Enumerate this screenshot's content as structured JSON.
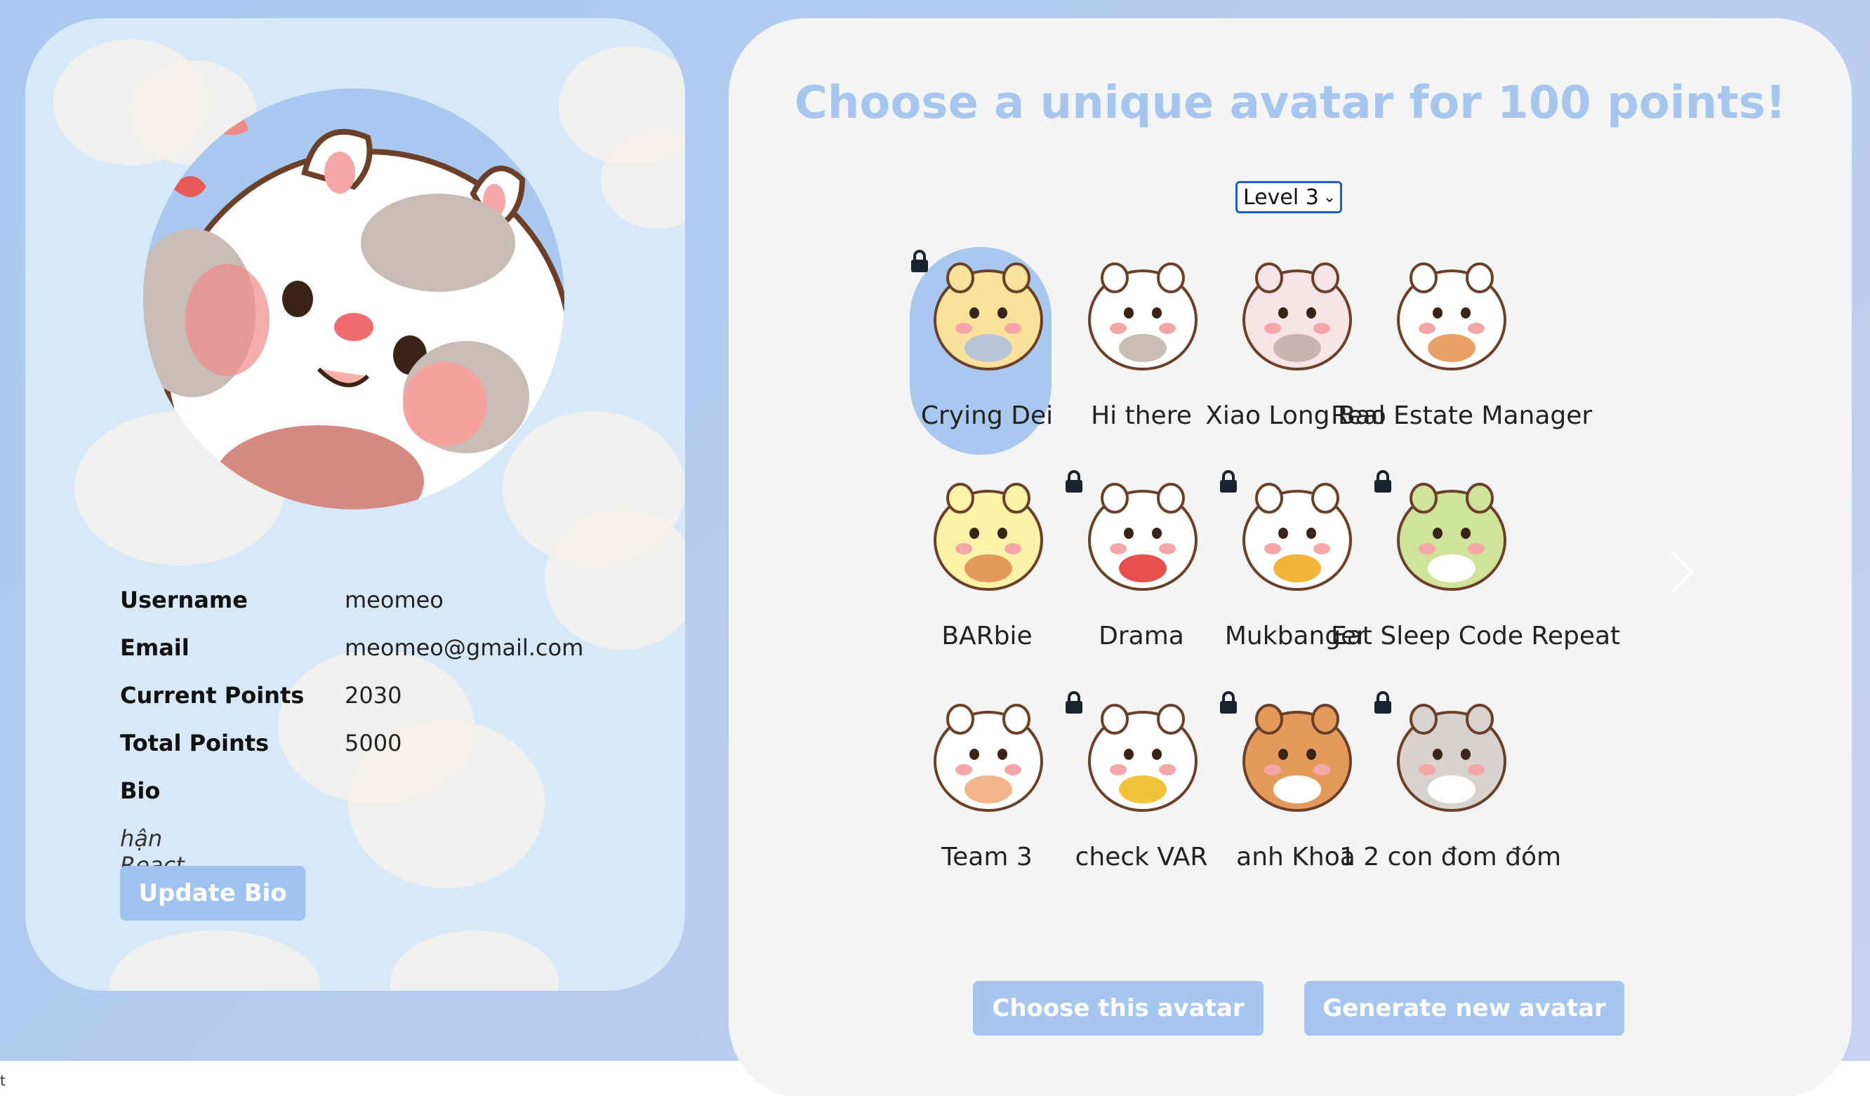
{
  "profile": {
    "fields": [
      {
        "label": "Username",
        "value": "meomeo"
      },
      {
        "label": "Email",
        "value": "meomeo@gmail.com"
      },
      {
        "label": "Current Points",
        "value": "2030"
      },
      {
        "label": "Total Points",
        "value": "5000"
      },
      {
        "label": "Bio",
        "value": ""
      }
    ],
    "bio_text": "hận React",
    "update_bio_label": "Update Bio"
  },
  "shop": {
    "heading": "Choose a unique avatar for 100 points!",
    "level_selected": "Level 3",
    "avatars": [
      {
        "name": "Crying Dei",
        "locked": true,
        "selected": true,
        "icon": "crying-bear-icon"
      },
      {
        "name": "Hi there",
        "locked": false,
        "selected": false,
        "icon": "cow-cat-icon"
      },
      {
        "name": "Xiao Long Bao",
        "locked": false,
        "selected": false,
        "icon": "tabby-cat-icon"
      },
      {
        "name": "Real Estate Manager",
        "locked": false,
        "selected": false,
        "icon": "calico-cat-icon"
      },
      {
        "name": "BARbie",
        "locked": false,
        "selected": false,
        "icon": "shiba-dance-icon"
      },
      {
        "name": "Drama",
        "locked": true,
        "selected": false,
        "icon": "popcorn-bear-icon"
      },
      {
        "name": "Mukbanger",
        "locked": true,
        "selected": false,
        "icon": "eating-bear-icon"
      },
      {
        "name": "Eat Sleep Code Repeat",
        "locked": true,
        "selected": false,
        "icon": "sleeping-bear-icon"
      },
      {
        "name": "Team 3",
        "locked": false,
        "selected": false,
        "icon": "laptop-bear-icon"
      },
      {
        "name": "check VAR",
        "locked": true,
        "selected": false,
        "icon": "duck-phone-icon"
      },
      {
        "name": "anh Khoa",
        "locked": true,
        "selected": false,
        "icon": "shiba-face-icon"
      },
      {
        "name": "1 2 con đom đóm",
        "locked": true,
        "selected": false,
        "icon": "grey-cat-icon"
      }
    ],
    "choose_label": "Choose this avatar",
    "generate_label": "Generate new avatar"
  },
  "corner_text": "t",
  "colors": {
    "accent": "#a6c6f0",
    "panel": "#f4f4f4",
    "profile_bg": "#d7e8f8",
    "select_border": "#1d5fc4"
  }
}
